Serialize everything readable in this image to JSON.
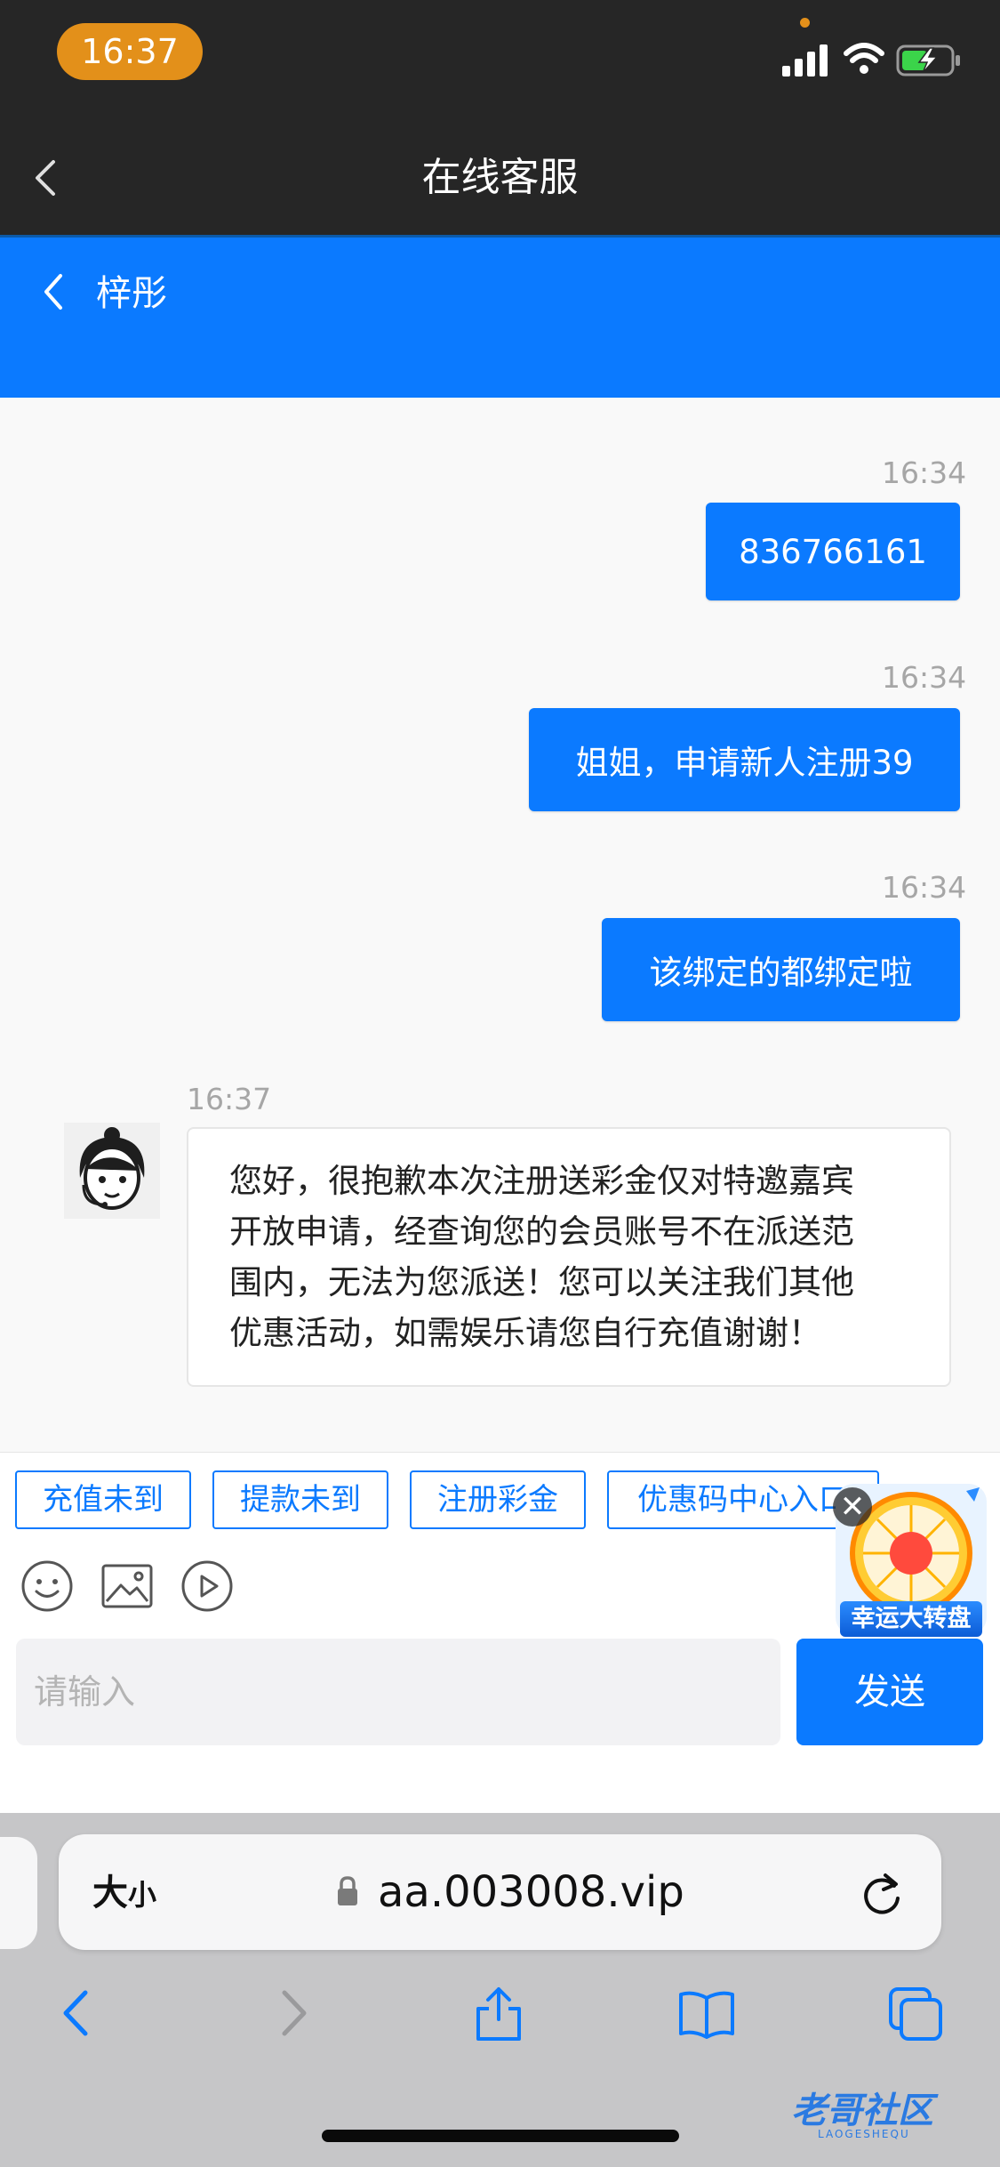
{
  "status_bar": {
    "time": "16:37"
  },
  "nav": {
    "title": "在线客服"
  },
  "chat_header": {
    "agent_name": "梓彤"
  },
  "messages": [
    {
      "direction": "out",
      "time": "16:34",
      "text": "836766161"
    },
    {
      "direction": "out",
      "time": "16:34",
      "text": "姐姐，申请新人注册39"
    },
    {
      "direction": "out",
      "time": "16:34",
      "text": "该绑定的都绑定啦"
    },
    {
      "direction": "in",
      "time": "16:37",
      "lines": [
        "您好，很抱歉本次注册送彩金仅对特邀嘉宾",
        "开放申请，经查询您的会员账号不在派送范",
        "围内，无法为您派送！您可以关注我们其他",
        "优惠活动，如需娱乐请您自行充值谢谢！"
      ]
    }
  ],
  "quick_replies": [
    "充值未到",
    "提款未到",
    "注册彩金",
    "优惠码中心入口"
  ],
  "composer": {
    "placeholder": "请输入",
    "send_label": "发送"
  },
  "promo": {
    "label": "幸运大转盘",
    "close": "✕"
  },
  "browser": {
    "text_size_big": "大",
    "text_size_small": "小",
    "url": "aa.003008.vip"
  },
  "watermark": {
    "text": "老哥社区",
    "sub": "LAOGESHEQU"
  },
  "colors": {
    "accent": "#0b7aff",
    "time_pill": "#e3901a",
    "nav_bg": "#262626"
  }
}
